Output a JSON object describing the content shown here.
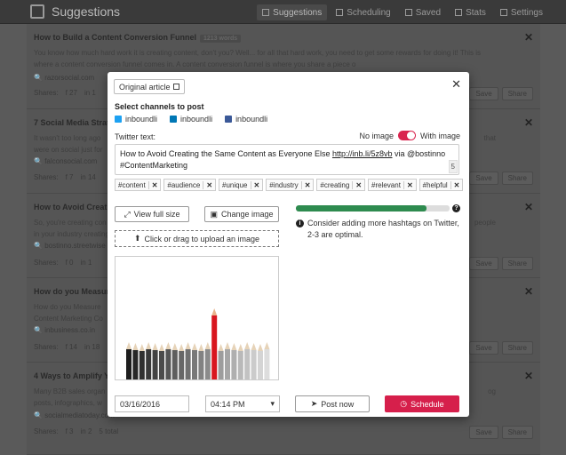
{
  "app": {
    "title": "Suggestions",
    "nav": [
      {
        "label": "Suggestions",
        "active": true
      },
      {
        "label": "Scheduling",
        "active": false
      },
      {
        "label": "Saved",
        "active": false
      },
      {
        "label": "Stats",
        "active": false
      },
      {
        "label": "Settings",
        "active": false
      }
    ]
  },
  "feed": {
    "cards": [
      {
        "title": "How to Build a Content Conversion Funnel",
        "badge": "1213 words",
        "desc": "You know how much hard work it is creating content, don't you? Well... for all that hard work, you need to get some rewards for doing it! This is where a content conversion funnel comes in. A content conversion funnel is where you share a piece o",
        "source": "razorsocial.com",
        "shares_label": "Shares:",
        "fb": "27",
        "li": "1",
        "save": "Save",
        "share": "Share"
      },
      {
        "title": "7 Social Media Strategies",
        "desc": "It wasn't too long ago",
        "desc2": "were on social just for",
        "desc_right": "that",
        "source": "falconsocial.com",
        "shares_label": "Shares:",
        "fb": "7",
        "li": "14",
        "save": "Save",
        "share": "Share"
      },
      {
        "title": "How to Avoid Creating",
        "desc": "So, you're creating con",
        "desc2": "in your industry creating",
        "desc_right": "people",
        "source": "bostinno.streetwise",
        "shares_label": "Shares:",
        "fb": "0",
        "li": "1",
        "save": "Save",
        "share": "Share"
      },
      {
        "title": "How do you Measure",
        "desc": "How do you Measure",
        "desc2": "Content Marketing Co",
        "source": "inbusiness.co.in",
        "shares_label": "Shares:",
        "fb": "14",
        "li": "18",
        "save": "Save",
        "share": "Share"
      },
      {
        "title": "4 Ways to Amplify Yo",
        "desc": "Many B2B sales organ",
        "desc2": "posts, infographics, w",
        "desc_right": "og",
        "source": "socialmediatoday.com",
        "shares_label": "Shares:",
        "fb": "3",
        "li": "2",
        "total": "5 total",
        "save": "Save",
        "share": "Share"
      }
    ]
  },
  "modal": {
    "original_article": "Original article",
    "select_channels": "Select channels to post",
    "channels": [
      {
        "name": "inboundli",
        "type": "twitter",
        "color": "#1da1f2"
      },
      {
        "name": "inboundli",
        "type": "linkedin",
        "color": "#0077b5"
      },
      {
        "name": "inboundli",
        "type": "facebook",
        "color": "#3b5998"
      }
    ],
    "twitter_text_label": "Twitter text:",
    "no_image": "No image",
    "with_image": "With image",
    "tweet_text": "How to Avoid Creating the Same Content as Everyone Else ",
    "tweet_link": "http://inb.li/5z8vb",
    "tweet_via": " via @bostinno",
    "tweet_line2": "#ContentMarketing",
    "char_count": "5",
    "tags": [
      "#content",
      "#audience",
      "#unique",
      "#industry",
      "#creating",
      "#relevant",
      "#helpful"
    ],
    "view_full_size": "View full size",
    "change_image": "Change image",
    "upload": "Click or drag to upload an image",
    "hashtag_progress": 0.85,
    "hint": "Consider adding more hashtags on Twitter, 2-3 are optimal.",
    "date": "03/16/2016",
    "time": "04:14 PM",
    "post_now": "Post now",
    "schedule": "Schedule",
    "accent": "#d61f4b",
    "progress_color": "#2e8b4f"
  }
}
